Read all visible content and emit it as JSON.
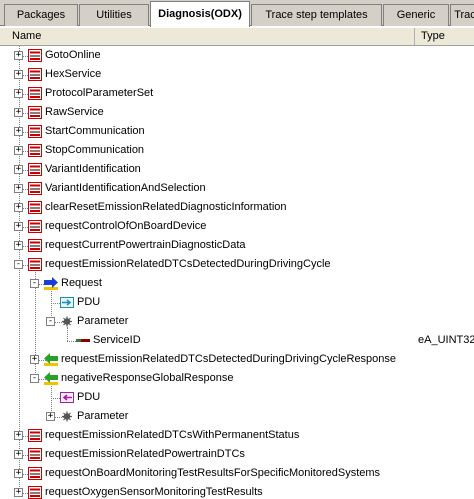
{
  "tabs": [
    {
      "label": "Packages",
      "active": false
    },
    {
      "label": "Utilities",
      "active": false
    },
    {
      "label": "Diagnosis(ODX)",
      "active": true
    },
    {
      "label": "Trace step templates",
      "active": false
    },
    {
      "label": "Generic",
      "active": false
    },
    {
      "label": "Trac",
      "active": false
    }
  ],
  "columns": {
    "name": "Name",
    "type": "Type"
  },
  "tree": [
    {
      "label": "GotoOnline",
      "depth": 0,
      "expander": "+",
      "icon": "service-icon"
    },
    {
      "label": "HexService",
      "depth": 0,
      "expander": "+",
      "icon": "service-icon"
    },
    {
      "label": "ProtocolParameterSet",
      "depth": 0,
      "expander": "+",
      "icon": "service-icon"
    },
    {
      "label": "RawService",
      "depth": 0,
      "expander": "+",
      "icon": "service-icon"
    },
    {
      "label": "StartCommunication",
      "depth": 0,
      "expander": "+",
      "icon": "service-icon"
    },
    {
      "label": "StopCommunication",
      "depth": 0,
      "expander": "+",
      "icon": "service-icon"
    },
    {
      "label": "VariantIdentification",
      "depth": 0,
      "expander": "+",
      "icon": "service-icon"
    },
    {
      "label": "VariantIdentificationAndSelection",
      "depth": 0,
      "expander": "+",
      "icon": "service-icon"
    },
    {
      "label": "clearResetEmissionRelatedDiagnosticInformation",
      "depth": 0,
      "expander": "+",
      "icon": "service-icon"
    },
    {
      "label": "requestControlOfOnBoardDevice",
      "depth": 0,
      "expander": "+",
      "icon": "service-icon"
    },
    {
      "label": "requestCurrentPowertrainDiagnosticData",
      "depth": 0,
      "expander": "+",
      "icon": "service-icon"
    },
    {
      "label": "requestEmissionRelatedDTCsDetectedDuringDrivingCycle",
      "depth": 0,
      "expander": "-",
      "icon": "service-icon"
    },
    {
      "label": "Request",
      "depth": 1,
      "expander": "-",
      "icon": "request-icon"
    },
    {
      "label": "PDU",
      "depth": 2,
      "expander": "",
      "icon": "pdu-icon"
    },
    {
      "label": "Parameter",
      "depth": 2,
      "expander": "-",
      "icon": "parameter-icon"
    },
    {
      "label": "ServiceID",
      "depth": 3,
      "expander": "",
      "icon": "param-value-icon",
      "type": "eA_UINT32"
    },
    {
      "label": "requestEmissionRelatedDTCsDetectedDuringDrivingCycleResponse",
      "depth": 1,
      "expander": "+",
      "icon": "response-icon"
    },
    {
      "label": "negativeResponseGlobalResponse",
      "depth": 1,
      "expander": "-",
      "icon": "response-icon"
    },
    {
      "label": "PDU",
      "depth": 2,
      "expander": "",
      "icon": "pdu-negative-icon"
    },
    {
      "label": "Parameter",
      "depth": 2,
      "expander": "+",
      "icon": "parameter-icon"
    },
    {
      "label": "requestEmissionRelatedDTCsWithPermanentStatus",
      "depth": 0,
      "expander": "+",
      "icon": "service-icon"
    },
    {
      "label": "requestEmissionRelatedPowertrainDTCs",
      "depth": 0,
      "expander": "+",
      "icon": "service-icon"
    },
    {
      "label": "requestOnBoardMonitoringTestResultsForSpecificMonitoredSystems",
      "depth": 0,
      "expander": "+",
      "icon": "service-icon"
    },
    {
      "label": "requestOxygenSensorMonitoringTestResults",
      "depth": 0,
      "expander": "+",
      "icon": "service-icon"
    }
  ],
  "colors": {
    "service_icon": "#cc0000",
    "request_arrow": "#1a3fd6",
    "response_arrow": "#2aa02a",
    "pdu_icon": "#1c8fb8",
    "pdu_negative_icon": "#a020a0"
  }
}
